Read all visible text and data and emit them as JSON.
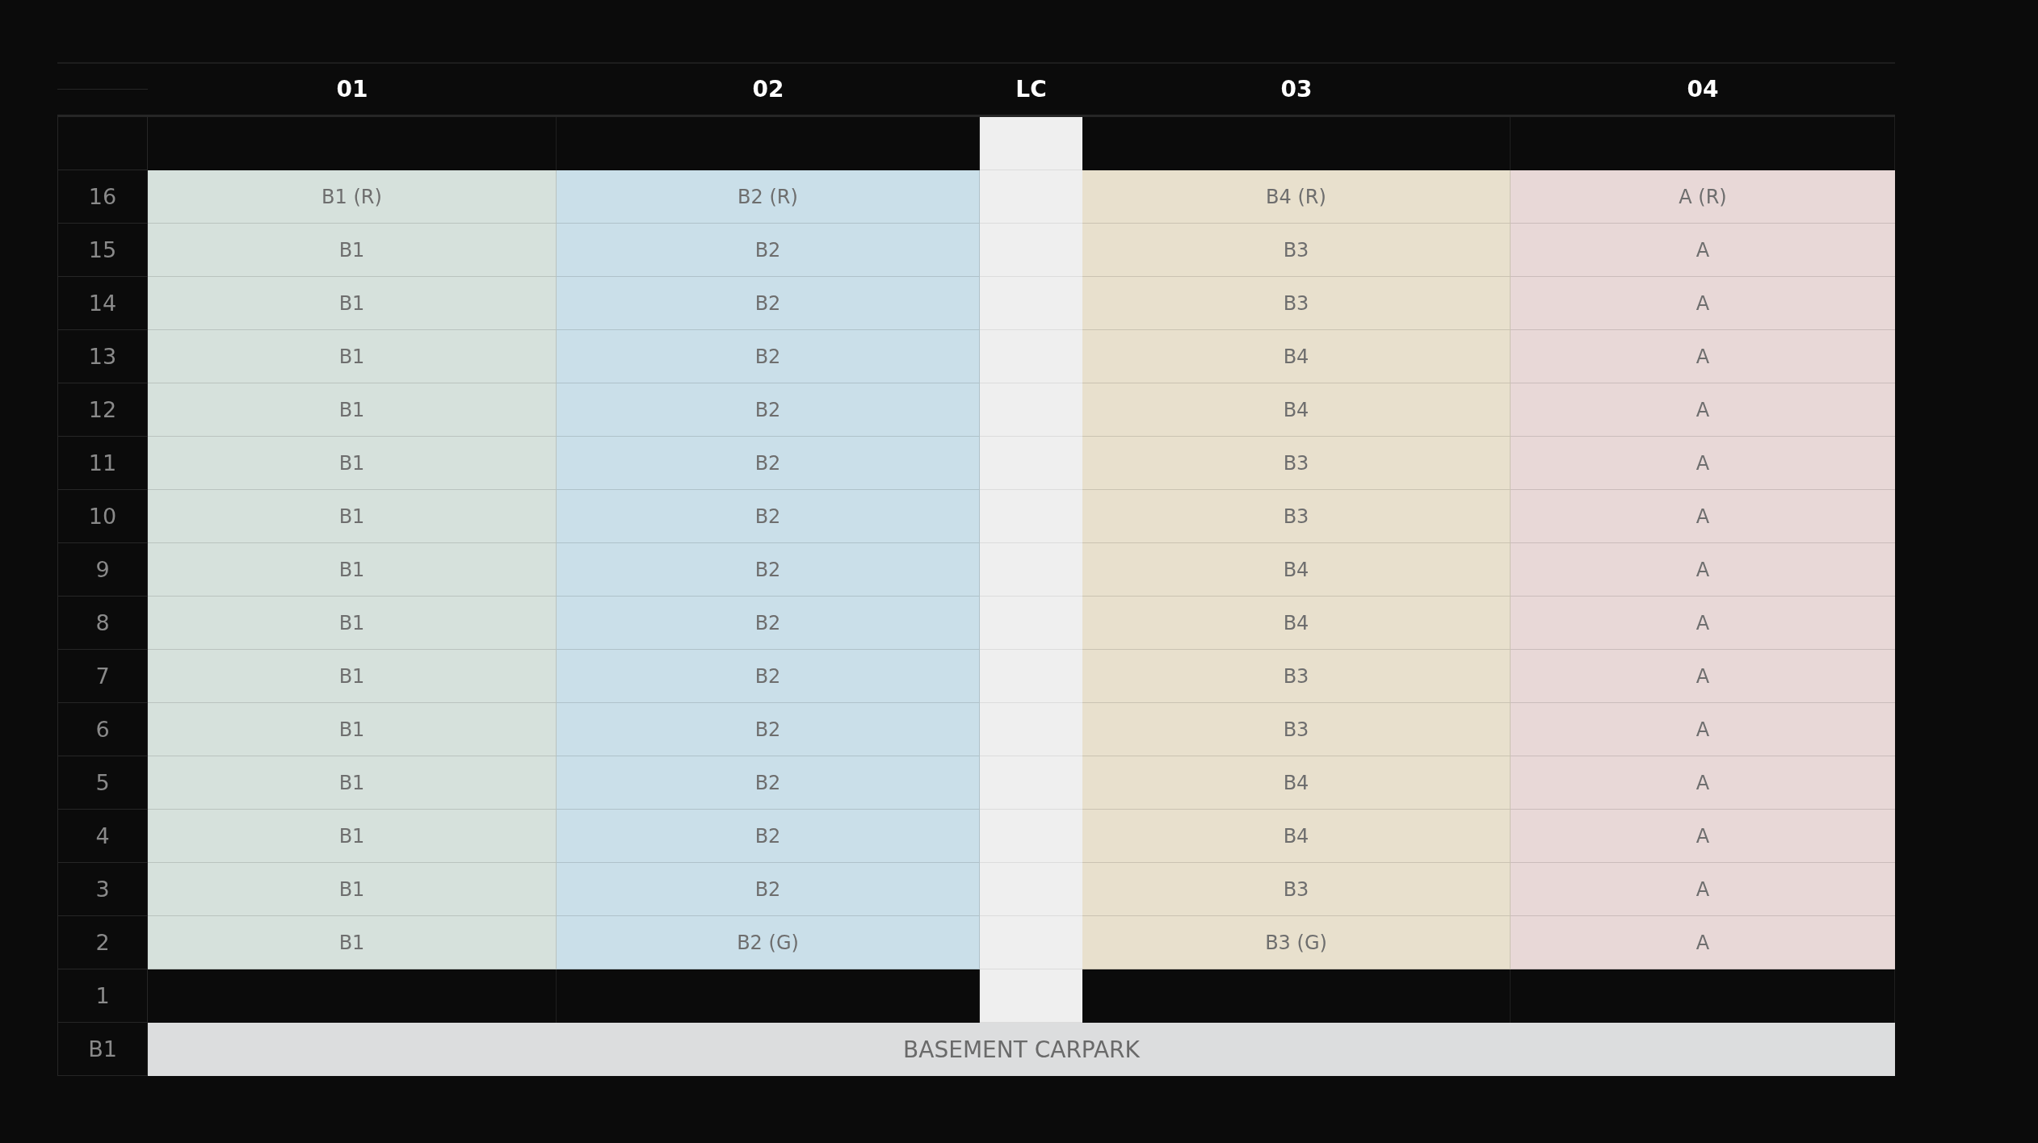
{
  "columns": [
    {
      "label": "01",
      "kind": "stack",
      "color": "#d6e1dc"
    },
    {
      "label": "02",
      "kind": "stack",
      "color": "#cadfe9"
    },
    {
      "label": "LC",
      "kind": "core",
      "color": "#efefef"
    },
    {
      "label": "03",
      "kind": "stack",
      "color": "#e8e0cd"
    },
    {
      "label": "04",
      "kind": "stack",
      "color": "#e8d8d7"
    }
  ],
  "rows": [
    {
      "kind": "podium"
    },
    {
      "kind": "units",
      "floor": "16",
      "units": [
        "B1 (R)",
        "B2 (R)",
        "B4 (R)",
        "A (R)"
      ]
    },
    {
      "kind": "units",
      "floor": "15",
      "units": [
        "B1",
        "B2",
        "B3",
        "A"
      ]
    },
    {
      "kind": "units",
      "floor": "14",
      "units": [
        "B1",
        "B2",
        "B3",
        "A"
      ]
    },
    {
      "kind": "units",
      "floor": "13",
      "units": [
        "B1",
        "B2",
        "B4",
        "A"
      ]
    },
    {
      "kind": "units",
      "floor": "12",
      "units": [
        "B1",
        "B2",
        "B4",
        "A"
      ]
    },
    {
      "kind": "units",
      "floor": "11",
      "units": [
        "B1",
        "B2",
        "B3",
        "A"
      ]
    },
    {
      "kind": "units",
      "floor": "10",
      "units": [
        "B1",
        "B2",
        "B3",
        "A"
      ]
    },
    {
      "kind": "units",
      "floor": "9",
      "units": [
        "B1",
        "B2",
        "B4",
        "A"
      ]
    },
    {
      "kind": "units",
      "floor": "8",
      "units": [
        "B1",
        "B2",
        "B4",
        "A"
      ]
    },
    {
      "kind": "units",
      "floor": "7",
      "units": [
        "B1",
        "B2",
        "B3",
        "A"
      ]
    },
    {
      "kind": "units",
      "floor": "6",
      "units": [
        "B1",
        "B2",
        "B3",
        "A"
      ]
    },
    {
      "kind": "units",
      "floor": "5",
      "units": [
        "B1",
        "B2",
        "B4",
        "A"
      ]
    },
    {
      "kind": "units",
      "floor": "4",
      "units": [
        "B1",
        "B2",
        "B4",
        "A"
      ]
    },
    {
      "kind": "units",
      "floor": "3",
      "units": [
        "B1",
        "B2",
        "B3",
        "A"
      ]
    },
    {
      "kind": "units",
      "floor": "2",
      "units": [
        "B1",
        "B2 (G)",
        "B3 (G)",
        "A"
      ]
    },
    {
      "kind": "podium",
      "floor": "1"
    },
    {
      "kind": "basement",
      "floor": "B1",
      "label": "BASEMENT CARPARK"
    }
  ]
}
